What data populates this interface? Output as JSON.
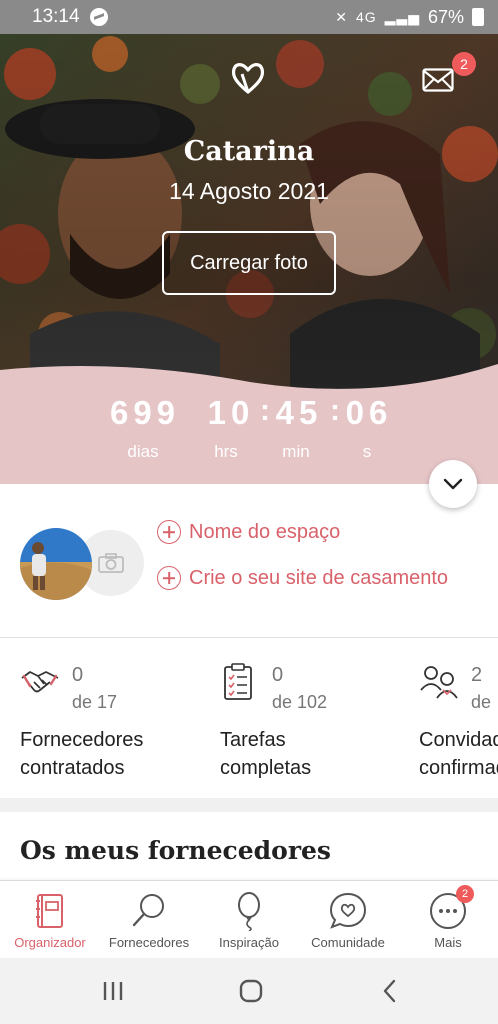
{
  "status_bar": {
    "time": "13:14",
    "network": "4G",
    "battery": "67%"
  },
  "hero": {
    "couple_name": "Catarina",
    "wedding_date": "14 Agosto 2021",
    "upload_button": "Carregar foto",
    "mail_badge": "2"
  },
  "countdown": {
    "days": "699",
    "hours": "10",
    "minutes": "45",
    "seconds": "06",
    "days_label": "dias",
    "hours_label": "hrs",
    "minutes_label": "min",
    "seconds_label": "s"
  },
  "profile": {
    "link_venue": "Nome do espaço",
    "link_site": "Crie o seu site de casamento"
  },
  "stats": [
    {
      "count": "0",
      "total": "de 17",
      "label_line1": "Fornecedores",
      "label_line2": "contratados",
      "icon": "handshake-icon"
    },
    {
      "count": "0",
      "total": "de 102",
      "label_line1": "Tarefas",
      "label_line2": "completas",
      "icon": "checklist-icon"
    },
    {
      "count": "2",
      "total": "de",
      "label_line1": "Convidados",
      "label_line2": "confirmados",
      "icon": "guests-icon"
    }
  ],
  "section_title": "Os meus fornecedores",
  "bottom_nav": [
    {
      "label": "Organizador",
      "icon": "notebook-icon",
      "active": true
    },
    {
      "label": "Fornecedores",
      "icon": "search-icon"
    },
    {
      "label": "Inspiração",
      "icon": "balloon-icon"
    },
    {
      "label": "Comunidade",
      "icon": "chat-heart-icon"
    },
    {
      "label": "Mais",
      "icon": "more-icon",
      "badge": "2"
    }
  ],
  "colors": {
    "accent": "#d9626a",
    "pink_band": "#e6c5c7",
    "badge": "#ef5b5b"
  }
}
